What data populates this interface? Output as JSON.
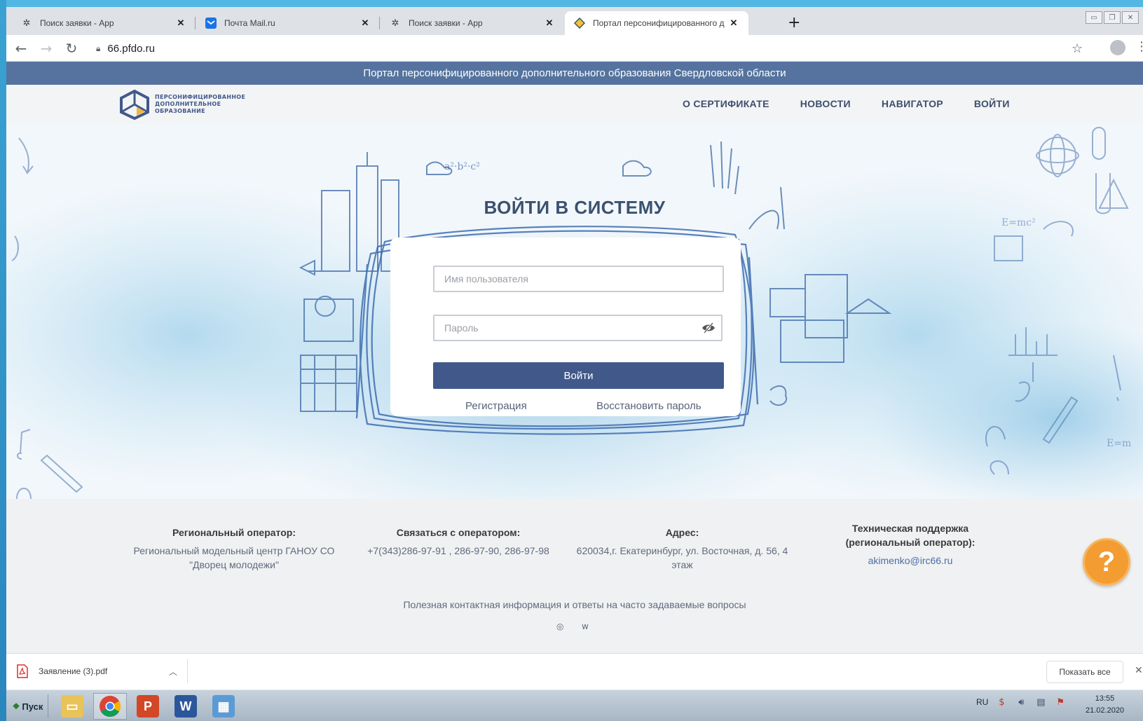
{
  "browser": {
    "tabs": [
      {
        "title": "Поиск заявки - App",
        "favicon": "gear-icon",
        "active": false
      },
      {
        "title": "Почта Mail.ru",
        "favicon": "mail-icon",
        "active": false
      },
      {
        "title": "Поиск заявки - App",
        "favicon": "gear-icon",
        "active": false
      },
      {
        "title": "Портал персонифицированного д",
        "favicon": "diamond-icon",
        "active": true
      }
    ],
    "new_tab": "+",
    "url": "66.pfdo.ru"
  },
  "page": {
    "banner": "Портал персонифицированного дополнительного образования Свердловской области",
    "logo_lines": [
      "ПЕРСОНИФИЦИРОВАННОЕ",
      "ДОПОЛНИТЕЛЬНОЕ",
      "ОБРАЗОВАНИЕ"
    ],
    "nav": [
      "О СЕРТИФИКАТЕ",
      "НОВОСТИ",
      "НАВИГАТОР",
      "ВОЙТИ"
    ],
    "login": {
      "title": "ВОЙТИ В СИСТЕМУ",
      "username_placeholder": "Имя пользователя",
      "password_placeholder": "Пароль",
      "submit": "Войти",
      "register": "Регистрация",
      "restore": "Восстановить пароль"
    },
    "footer": {
      "operator_head": "Региональный оператор:",
      "operator_body": "Региональный модельный центр ГАНОУ СО \"Дворец молодежи\"",
      "contact_head": "Связаться с оператором:",
      "contact_body": "+7(343)286-97-91 , 286-97-90, 286-97-98",
      "address_head": "Адрес:",
      "address_body": "620034,г. Екатеринбург, ул. Восточная, д. 56, 4 этаж",
      "support_head": "Техническая поддержка (региональный оператор):",
      "support_body": "akimenko@irc66.ru",
      "faq": "Полезная контактная информация и ответы на часто задаваемые вопросы",
      "help": "?"
    }
  },
  "downloads": {
    "file": "Заявление (3).pdf",
    "show_all": "Показать все"
  },
  "taskbar": {
    "start": "Пуск",
    "lang": "RU",
    "time": "13:55",
    "date": "21.02.2020"
  },
  "colors": {
    "banner": "#55739e",
    "primary": "#41598a",
    "help": "#f39c32"
  }
}
